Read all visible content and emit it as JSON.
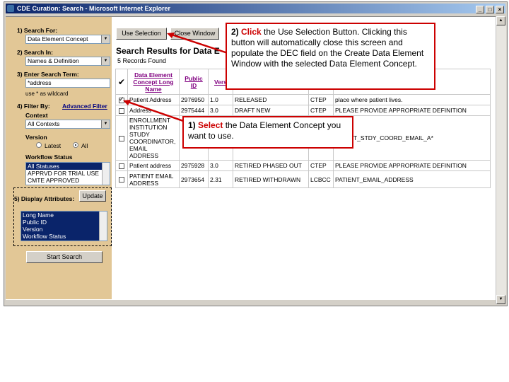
{
  "window": {
    "title": "CDE Curation: Search - Microsoft Internet Explorer"
  },
  "search_panel": {
    "search_for_label": "1) Search For:",
    "search_for_value": "Data Element Concept",
    "search_in_label": "2) Search In:",
    "search_in_value": "Names & Definition",
    "term_label": "3) Enter Search Term:",
    "term_value": "*address",
    "wildcard_note": "use * as wildcard",
    "filter_label": "4) Filter By:",
    "advanced_filter_link": "Advanced Filter",
    "context_label": "Context",
    "context_value": "All Contexts",
    "version_label": "Version",
    "version_latest": "Latest",
    "version_all": "All",
    "workflow_label": "Workflow Status",
    "workflow_options": [
      "All Statuses",
      "APPRVD FOR TRIAL USE",
      "CMTE APPROVED"
    ],
    "display_label": "5) Display Attributes:",
    "update_button": "Update",
    "display_options": [
      "Long Name",
      "Public ID",
      "Version",
      "Workflow Status"
    ],
    "start_search_button": "Start Search"
  },
  "results": {
    "use_selection_button": "Use Selection",
    "close_window_button": "Close Window",
    "title": "Search Results for Data E",
    "count": "5 Records Found",
    "headers": {
      "check": "✔",
      "long_name": "Data Element Concept Long Name",
      "public_id": "Public ID",
      "version": "Vers"
    },
    "rows": [
      {
        "name": "Patient Address",
        "id": "2976950",
        "ver": "1.0",
        "status": "RELEASED",
        "ctx": "CTEP",
        "def": "place where patient lives.",
        "checked": true
      },
      {
        "name": "Address",
        "id": "2975444",
        "ver": "3.0",
        "status": "DRAFT NEW",
        "ctx": "CTEP",
        "def": "PLEASE PROVIDE APPROPRIATE DEFINITION",
        "checked": false
      },
      {
        "name": "ENROLLMENT INSTITUTION STUDY COORDINATOR, EMAIL ADDRESS",
        "id": "",
        "ver": "",
        "status": "",
        "ctx": "",
        "def": "IL_INST_STDY_COORD_EMAIL_A*",
        "checked": false
      },
      {
        "name": "Patient address",
        "id": "2975928",
        "ver": "3.0",
        "status": "RETIRED PHASED OUT",
        "ctx": "CTEP",
        "def": "PLEASE PROVIDE APPROPRIATE DEFINITION",
        "checked": false
      },
      {
        "name": "PATIENT EMAIL ADDRESS",
        "id": "2973654",
        "ver": "2.31",
        "status": "RETIRED WITHDRAWN",
        "ctx": "LCBCC",
        "def": "PATIENT_EMAIL_ADDRESS",
        "checked": false
      }
    ]
  },
  "callouts": {
    "step2_num": "2)",
    "step2_emph": "Click",
    "step2_text": "the Use Selection Button. Clicking this button will automatically close this screen and populate the DEC field on the Create Data Element Window with the selected Data Element Concept.",
    "step1_num": "1)",
    "step1_emph": "Select",
    "step1_text": "the Data Element Concept you want to use."
  },
  "colors": {
    "sidebar": "#e2c796",
    "callout_border": "#cc0000",
    "selection": "#0a246a"
  }
}
